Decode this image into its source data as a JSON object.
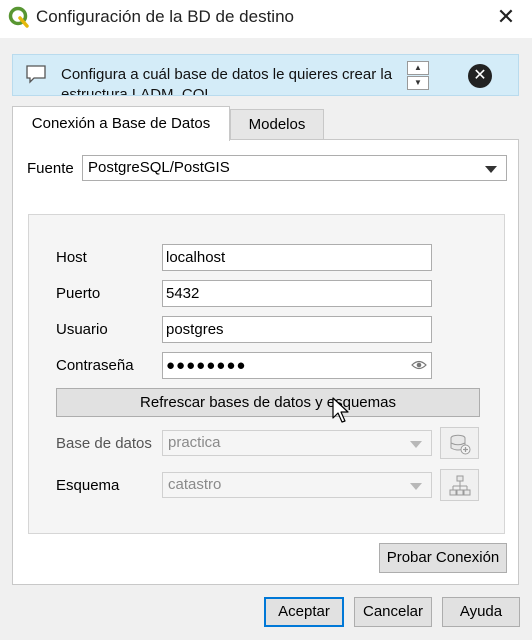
{
  "window": {
    "title": "Configuración de la BD de destino",
    "close_glyph": "✕"
  },
  "banner": {
    "message": "Configura a cuál base de datos le quieres crear la estructura LADM_COL",
    "dismiss_glyph": "✕",
    "spin_up": "▲",
    "spin_down": "▼"
  },
  "tabs": [
    {
      "label": "Conexión a Base de Datos",
      "active": true
    },
    {
      "label": "Modelos",
      "active": false
    }
  ],
  "source": {
    "label": "Fuente",
    "value": "PostgreSQL/PostGIS"
  },
  "connection": {
    "host_label": "Host",
    "host_value": "localhost",
    "port_label": "Puerto",
    "port_value": "5432",
    "user_label": "Usuario",
    "user_value": "postgres",
    "password_label": "Contraseña",
    "password_mask": "●●●●●●●●",
    "refresh_label": "Refrescar bases de datos y esquemas",
    "database_label": "Base de datos",
    "database_value": "practica",
    "schema_label": "Esquema",
    "schema_value": "catastro",
    "test_label": "Probar Conexión"
  },
  "footer": {
    "ok": "Aceptar",
    "cancel": "Cancelar",
    "help": "Ayuda"
  },
  "colors": {
    "banner_bg": "#d4ecf8",
    "default_button_border": "#0078d7",
    "qgis_green": "#589632"
  }
}
